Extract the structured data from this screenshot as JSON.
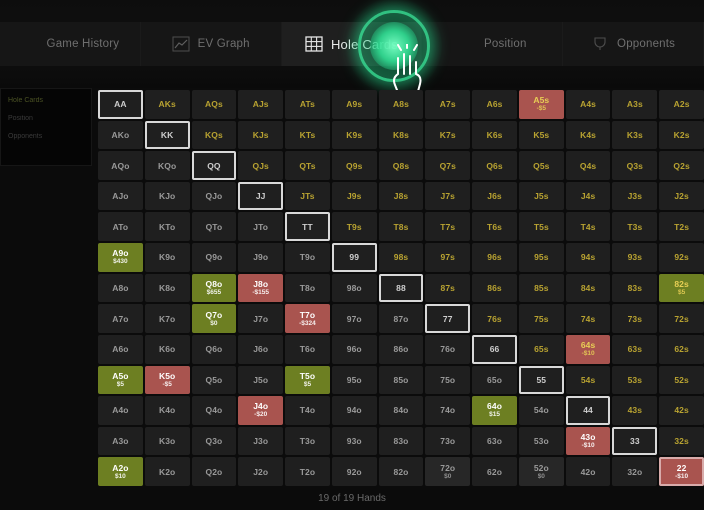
{
  "nav": {
    "tabs": [
      {
        "label": "Game History",
        "icon": "history-icon",
        "active": false
      },
      {
        "label": "EV Graph",
        "icon": "chart-icon",
        "active": false
      },
      {
        "label": "Hole Cards",
        "icon": "grid-icon",
        "active": true
      },
      {
        "label": "Position",
        "icon": "position-icon",
        "active": false
      },
      {
        "label": "Opponents",
        "icon": "trophy-icon",
        "active": false
      }
    ]
  },
  "side_panel": {
    "items": [
      {
        "label": "Hole Cards"
      },
      {
        "label": "Position"
      },
      {
        "label": "Opponents"
      }
    ]
  },
  "footer": {
    "status": "19 of 19 Hands"
  },
  "colors": {
    "positive": "#6d7f22",
    "negative": "#a9544f",
    "cell_bg": "#1f1f1f",
    "suited_text": "#b9a331",
    "selection": "#d8d8d8",
    "glow": "#2ee596"
  },
  "matrix": {
    "ranks": [
      "A",
      "K",
      "Q",
      "J",
      "T",
      "9",
      "8",
      "7",
      "6",
      "5",
      "4",
      "3",
      "2"
    ],
    "rows": [
      [
        {
          "hand": "AA",
          "kind": "pair",
          "state": "sel"
        },
        {
          "hand": "AKs",
          "kind": "suited"
        },
        {
          "hand": "AQs",
          "kind": "suited"
        },
        {
          "hand": "AJs",
          "kind": "suited"
        },
        {
          "hand": "ATs",
          "kind": "suited"
        },
        {
          "hand": "A9s",
          "kind": "suited"
        },
        {
          "hand": "A8s",
          "kind": "suited"
        },
        {
          "hand": "A7s",
          "kind": "suited"
        },
        {
          "hand": "A6s",
          "kind": "suited"
        },
        {
          "hand": "A5s",
          "kind": "suited",
          "result": "neg",
          "amount": "-$5"
        },
        {
          "hand": "A4s",
          "kind": "suited"
        },
        {
          "hand": "A3s",
          "kind": "suited"
        },
        {
          "hand": "A2s",
          "kind": "suited"
        }
      ],
      [
        {
          "hand": "AKo",
          "kind": "offs"
        },
        {
          "hand": "KK",
          "kind": "pair",
          "state": "sel"
        },
        {
          "hand": "KQs",
          "kind": "suited"
        },
        {
          "hand": "KJs",
          "kind": "suited"
        },
        {
          "hand": "KTs",
          "kind": "suited"
        },
        {
          "hand": "K9s",
          "kind": "suited"
        },
        {
          "hand": "K8s",
          "kind": "suited"
        },
        {
          "hand": "K7s",
          "kind": "suited"
        },
        {
          "hand": "K6s",
          "kind": "suited"
        },
        {
          "hand": "K5s",
          "kind": "suited"
        },
        {
          "hand": "K4s",
          "kind": "suited"
        },
        {
          "hand": "K3s",
          "kind": "suited"
        },
        {
          "hand": "K2s",
          "kind": "suited"
        }
      ],
      [
        {
          "hand": "AQo",
          "kind": "offs"
        },
        {
          "hand": "KQo",
          "kind": "offs"
        },
        {
          "hand": "QQ",
          "kind": "pair",
          "state": "sel"
        },
        {
          "hand": "QJs",
          "kind": "suited"
        },
        {
          "hand": "QTs",
          "kind": "suited"
        },
        {
          "hand": "Q9s",
          "kind": "suited"
        },
        {
          "hand": "Q8s",
          "kind": "suited"
        },
        {
          "hand": "Q7s",
          "kind": "suited"
        },
        {
          "hand": "Q6s",
          "kind": "suited"
        },
        {
          "hand": "Q5s",
          "kind": "suited"
        },
        {
          "hand": "Q4s",
          "kind": "suited"
        },
        {
          "hand": "Q3s",
          "kind": "suited"
        },
        {
          "hand": "Q2s",
          "kind": "suited"
        }
      ],
      [
        {
          "hand": "AJo",
          "kind": "offs"
        },
        {
          "hand": "KJo",
          "kind": "offs"
        },
        {
          "hand": "QJo",
          "kind": "offs"
        },
        {
          "hand": "JJ",
          "kind": "pair",
          "state": "sel"
        },
        {
          "hand": "JTs",
          "kind": "suited"
        },
        {
          "hand": "J9s",
          "kind": "suited"
        },
        {
          "hand": "J8s",
          "kind": "suited"
        },
        {
          "hand": "J7s",
          "kind": "suited"
        },
        {
          "hand": "J6s",
          "kind": "suited"
        },
        {
          "hand": "J5s",
          "kind": "suited"
        },
        {
          "hand": "J4s",
          "kind": "suited"
        },
        {
          "hand": "J3s",
          "kind": "suited"
        },
        {
          "hand": "J2s",
          "kind": "suited"
        }
      ],
      [
        {
          "hand": "ATo",
          "kind": "offs"
        },
        {
          "hand": "KTo",
          "kind": "offs"
        },
        {
          "hand": "QTo",
          "kind": "offs"
        },
        {
          "hand": "JTo",
          "kind": "offs"
        },
        {
          "hand": "TT",
          "kind": "pair",
          "state": "sel"
        },
        {
          "hand": "T9s",
          "kind": "suited"
        },
        {
          "hand": "T8s",
          "kind": "suited"
        },
        {
          "hand": "T7s",
          "kind": "suited"
        },
        {
          "hand": "T6s",
          "kind": "suited"
        },
        {
          "hand": "T5s",
          "kind": "suited"
        },
        {
          "hand": "T4s",
          "kind": "suited"
        },
        {
          "hand": "T3s",
          "kind": "suited"
        },
        {
          "hand": "T2s",
          "kind": "suited"
        }
      ],
      [
        {
          "hand": "A9o",
          "kind": "offs",
          "result": "pos",
          "amount": "$430"
        },
        {
          "hand": "K9o",
          "kind": "offs"
        },
        {
          "hand": "Q9o",
          "kind": "offs"
        },
        {
          "hand": "J9o",
          "kind": "offs"
        },
        {
          "hand": "T9o",
          "kind": "offs"
        },
        {
          "hand": "99",
          "kind": "pair",
          "state": "sel"
        },
        {
          "hand": "98s",
          "kind": "suited"
        },
        {
          "hand": "97s",
          "kind": "suited"
        },
        {
          "hand": "96s",
          "kind": "suited"
        },
        {
          "hand": "95s",
          "kind": "suited"
        },
        {
          "hand": "94s",
          "kind": "suited"
        },
        {
          "hand": "93s",
          "kind": "suited"
        },
        {
          "hand": "92s",
          "kind": "suited"
        }
      ],
      [
        {
          "hand": "A8o",
          "kind": "offs"
        },
        {
          "hand": "K8o",
          "kind": "offs"
        },
        {
          "hand": "Q8o",
          "kind": "offs",
          "result": "pos",
          "amount": "$655"
        },
        {
          "hand": "J8o",
          "kind": "offs",
          "result": "neg",
          "amount": "-$155"
        },
        {
          "hand": "T8o",
          "kind": "offs"
        },
        {
          "hand": "98o",
          "kind": "offs"
        },
        {
          "hand": "88",
          "kind": "pair",
          "state": "sel"
        },
        {
          "hand": "87s",
          "kind": "suited"
        },
        {
          "hand": "86s",
          "kind": "suited"
        },
        {
          "hand": "85s",
          "kind": "suited"
        },
        {
          "hand": "84s",
          "kind": "suited"
        },
        {
          "hand": "83s",
          "kind": "suited"
        },
        {
          "hand": "82s",
          "kind": "suited",
          "result": "pos",
          "amount": "$5"
        }
      ],
      [
        {
          "hand": "A7o",
          "kind": "offs"
        },
        {
          "hand": "K7o",
          "kind": "offs"
        },
        {
          "hand": "Q7o",
          "kind": "offs",
          "result": "pos",
          "amount": "$0"
        },
        {
          "hand": "J7o",
          "kind": "offs"
        },
        {
          "hand": "T7o",
          "kind": "offs",
          "result": "neg",
          "amount": "-$324"
        },
        {
          "hand": "97o",
          "kind": "offs"
        },
        {
          "hand": "87o",
          "kind": "offs"
        },
        {
          "hand": "77",
          "kind": "pair",
          "state": "sel"
        },
        {
          "hand": "76s",
          "kind": "suited"
        },
        {
          "hand": "75s",
          "kind": "suited"
        },
        {
          "hand": "74s",
          "kind": "suited"
        },
        {
          "hand": "73s",
          "kind": "suited"
        },
        {
          "hand": "72s",
          "kind": "suited"
        }
      ],
      [
        {
          "hand": "A6o",
          "kind": "offs"
        },
        {
          "hand": "K6o",
          "kind": "offs"
        },
        {
          "hand": "Q6o",
          "kind": "offs"
        },
        {
          "hand": "J6o",
          "kind": "offs"
        },
        {
          "hand": "T6o",
          "kind": "offs"
        },
        {
          "hand": "96o",
          "kind": "offs"
        },
        {
          "hand": "86o",
          "kind": "offs"
        },
        {
          "hand": "76o",
          "kind": "offs"
        },
        {
          "hand": "66",
          "kind": "pair",
          "state": "sel"
        },
        {
          "hand": "65s",
          "kind": "suited"
        },
        {
          "hand": "64s",
          "kind": "suited",
          "result": "neg",
          "amount": "-$10"
        },
        {
          "hand": "63s",
          "kind": "suited"
        },
        {
          "hand": "62s",
          "kind": "suited"
        }
      ],
      [
        {
          "hand": "A5o",
          "kind": "offs",
          "result": "pos",
          "amount": "$5"
        },
        {
          "hand": "K5o",
          "kind": "offs",
          "result": "neg",
          "amount": "-$5"
        },
        {
          "hand": "Q5o",
          "kind": "offs"
        },
        {
          "hand": "J5o",
          "kind": "offs"
        },
        {
          "hand": "T5o",
          "kind": "offs",
          "result": "pos",
          "amount": "$5"
        },
        {
          "hand": "95o",
          "kind": "offs"
        },
        {
          "hand": "85o",
          "kind": "offs"
        },
        {
          "hand": "75o",
          "kind": "offs"
        },
        {
          "hand": "65o",
          "kind": "offs"
        },
        {
          "hand": "55",
          "kind": "pair",
          "state": "sel"
        },
        {
          "hand": "54s",
          "kind": "suited"
        },
        {
          "hand": "53s",
          "kind": "suited"
        },
        {
          "hand": "52s",
          "kind": "suited"
        }
      ],
      [
        {
          "hand": "A4o",
          "kind": "offs"
        },
        {
          "hand": "K4o",
          "kind": "offs"
        },
        {
          "hand": "Q4o",
          "kind": "offs"
        },
        {
          "hand": "J4o",
          "kind": "offs",
          "result": "neg",
          "amount": "-$20"
        },
        {
          "hand": "T4o",
          "kind": "offs"
        },
        {
          "hand": "94o",
          "kind": "offs"
        },
        {
          "hand": "84o",
          "kind": "offs"
        },
        {
          "hand": "74o",
          "kind": "offs"
        },
        {
          "hand": "64o",
          "kind": "offs",
          "result": "pos",
          "amount": "$15"
        },
        {
          "hand": "54o",
          "kind": "offs"
        },
        {
          "hand": "44",
          "kind": "pair",
          "state": "sel"
        },
        {
          "hand": "43s",
          "kind": "suited"
        },
        {
          "hand": "42s",
          "kind": "suited"
        }
      ],
      [
        {
          "hand": "A3o",
          "kind": "offs"
        },
        {
          "hand": "K3o",
          "kind": "offs"
        },
        {
          "hand": "Q3o",
          "kind": "offs"
        },
        {
          "hand": "J3o",
          "kind": "offs"
        },
        {
          "hand": "T3o",
          "kind": "offs"
        },
        {
          "hand": "93o",
          "kind": "offs"
        },
        {
          "hand": "83o",
          "kind": "offs"
        },
        {
          "hand": "73o",
          "kind": "offs"
        },
        {
          "hand": "63o",
          "kind": "offs"
        },
        {
          "hand": "53o",
          "kind": "offs"
        },
        {
          "hand": "43o",
          "kind": "offs",
          "result": "neg",
          "amount": "-$10"
        },
        {
          "hand": "33",
          "kind": "pair",
          "state": "sel"
        },
        {
          "hand": "32s",
          "kind": "suited"
        }
      ],
      [
        {
          "hand": "A2o",
          "kind": "offs",
          "result": "pos",
          "amount": "$10"
        },
        {
          "hand": "K2o",
          "kind": "offs"
        },
        {
          "hand": "Q2o",
          "kind": "offs"
        },
        {
          "hand": "J2o",
          "kind": "offs"
        },
        {
          "hand": "T2o",
          "kind": "offs"
        },
        {
          "hand": "92o",
          "kind": "offs"
        },
        {
          "hand": "82o",
          "kind": "offs"
        },
        {
          "hand": "72o",
          "kind": "offs",
          "amount": "$0",
          "result": "neutral"
        },
        {
          "hand": "62o",
          "kind": "offs"
        },
        {
          "hand": "52o",
          "kind": "offs",
          "amount": "$0",
          "result": "neutral"
        },
        {
          "hand": "42o",
          "kind": "offs"
        },
        {
          "hand": "32o",
          "kind": "offs"
        },
        {
          "hand": "22",
          "kind": "pair",
          "result": "neg",
          "amount": "-$10",
          "state": "sel-soft"
        }
      ]
    ]
  }
}
